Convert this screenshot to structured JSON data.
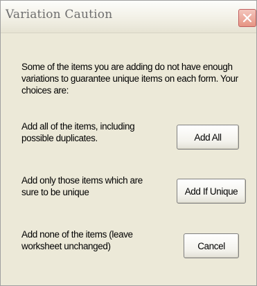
{
  "window": {
    "title": "Variation Caution"
  },
  "dialog": {
    "intro": "Some of the items you are adding do not have enough variations to guarantee unique items on each form. Your choices are:",
    "options": [
      {
        "description": "Add all of the items, including possible duplicates.",
        "button_label": "Add All"
      },
      {
        "description": "Add only those items which are sure to be unique",
        "button_label": "Add If Unique"
      },
      {
        "description": "Add none of the items (leave worksheet unchanged)",
        "button_label": "Cancel"
      }
    ]
  },
  "icons": {
    "close": "close-icon"
  },
  "colors": {
    "dialog_background": "#ece9d8",
    "title_text": "#6e6e6e",
    "close_button": "#e69483"
  }
}
